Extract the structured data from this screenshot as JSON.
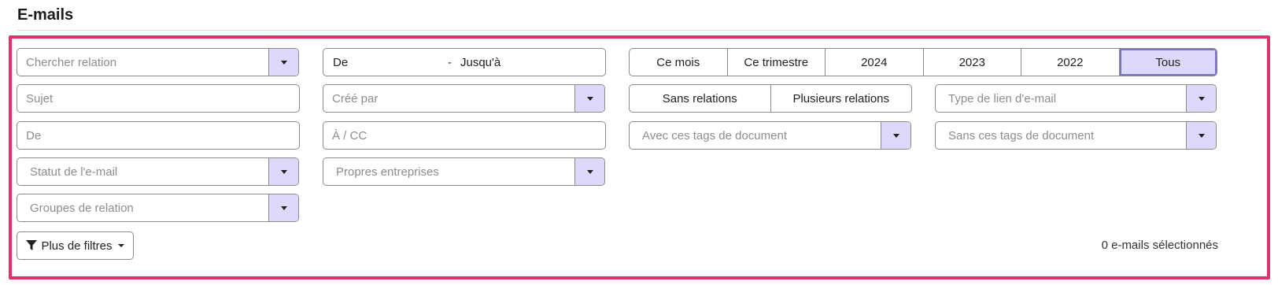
{
  "page": {
    "title": "E-mails"
  },
  "filters": {
    "relation_search": {
      "placeholder": "Chercher relation"
    },
    "date_range": {
      "from": "De",
      "separator": "-",
      "to": "Jusqu'à"
    },
    "period_buttons": [
      {
        "label": "Ce mois",
        "active": false
      },
      {
        "label": "Ce trimestre",
        "active": false
      },
      {
        "label": "2024",
        "active": false
      },
      {
        "label": "2023",
        "active": false
      },
      {
        "label": "2022",
        "active": false
      },
      {
        "label": "Tous",
        "active": true
      }
    ],
    "subject": {
      "placeholder": "Sujet"
    },
    "created_by": {
      "placeholder": "Créé par"
    },
    "relation_buttons": [
      {
        "label": "Sans relations"
      },
      {
        "label": "Plusieurs relations"
      }
    ],
    "email_link_type": {
      "placeholder": "Type de lien d'e-mail"
    },
    "from_field": {
      "placeholder": "De"
    },
    "to_cc_field": {
      "placeholder": "À / CC"
    },
    "with_tags": {
      "placeholder": "Avec ces tags de document"
    },
    "without_tags": {
      "placeholder": "Sans ces tags de document"
    },
    "email_status": {
      "placeholder": "Statut de l'e-mail"
    },
    "own_companies": {
      "placeholder": "Propres entreprises"
    },
    "relation_groups": {
      "placeholder": "Groupes de relation"
    },
    "more_filters": {
      "label": "Plus de filtres"
    }
  },
  "status": {
    "selected_count": "0 e-mails sélectionnés"
  },
  "colors": {
    "accent_border": "#e0336b",
    "select_bg": "#dcd9fb"
  }
}
